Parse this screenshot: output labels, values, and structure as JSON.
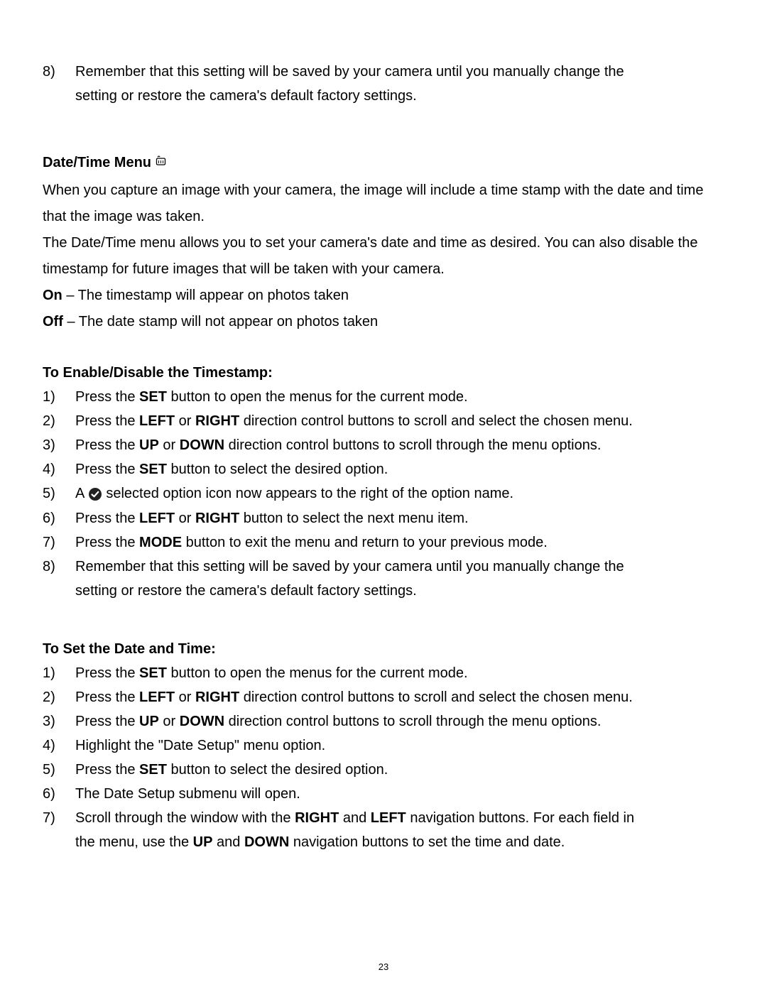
{
  "item8": {
    "num": "8)",
    "text1": "Remember that this setting will be saved by your camera until you manually change the ",
    "text2": "setting or restore the camera's default factory settings."
  },
  "dtmenu": {
    "heading": "Date/Time Menu",
    "para1": "When you capture an image with your camera, the image will include a time stamp with the date and time that the image was taken.",
    "para2": "The Date/Time menu allows you to set your camera's date and time as desired. You can also disable the timestamp for future images that will be taken with your camera.",
    "on_label": "On",
    "on_text": " – The timestamp will appear on photos taken",
    "off_label": "Off",
    "off_text": " – The date stamp will not appear on photos taken"
  },
  "ts": {
    "heading": "To Enable/Disable the Timestamp:",
    "n1": "1)",
    "t1a": "Press the ",
    "t1b": "SET",
    "t1c": " button to open the menus for the current mode.",
    "n2": "2)",
    "t2a": "Press the ",
    "t2b": "LEFT",
    "t2c": " or ",
    "t2d": "RIGHT",
    "t2e": " direction control buttons to scroll and select the chosen menu.",
    "n3": "3)",
    "t3a": "Press the ",
    "t3b": "UP",
    "t3c": " or ",
    "t3d": "DOWN",
    "t3e": " direction control buttons to scroll through the menu options.",
    "n4": "4)",
    "t4a": "Press the ",
    "t4b": "SET",
    "t4c": " button to select the desired option.",
    "n5": "5)",
    "t5a": "A  ",
    "t5b": "  selected option icon now appears to the right of the option name.",
    "n6": "6)",
    "t6a": "Press the ",
    "t6b": "LEFT",
    "t6c": " or ",
    "t6d": "RIGHT",
    "t6e": " button to select the next menu item.",
    "n7": "7)",
    "t7a": "Press the ",
    "t7b": "MODE",
    "t7c": " button to exit the menu and return to your previous mode.",
    "n8": "8)",
    "t8a": "Remember that this setting will be saved by your camera until you manually change the ",
    "t8b": "setting or restore the camera's default factory settings."
  },
  "sd": {
    "heading": "To Set the Date and Time:",
    "n1": "1)",
    "t1a": "Press the ",
    "t1b": "SET",
    "t1c": " button to open the menus for the current mode.",
    "n2": "2)",
    "t2a": "Press the ",
    "t2b": "LEFT",
    "t2c": " or ",
    "t2d": "RIGHT",
    "t2e": " direction control buttons to scroll and select the chosen menu.",
    "n3": "3)",
    "t3a": "Press the ",
    "t3b": "UP",
    "t3c": " or ",
    "t3d": "DOWN",
    "t3e": " direction control buttons to scroll through the menu options.",
    "n4": "4)",
    "t4": "Highlight the \"Date Setup\" menu option.",
    "n5": "5)",
    "t5a": "Press the ",
    "t5b": "SET",
    "t5c": " button to select the desired option.",
    "n6": "6)",
    "t6": "The Date Setup submenu will open.",
    "n7": "7)",
    "t7a": "Scroll through the window with the ",
    "t7b": "RIGHT",
    "t7c": " and ",
    "t7d": "LEFT",
    "t7e": " navigation buttons. For each field in ",
    "t7f": "the menu, use the ",
    "t7g": "UP",
    "t7h": " and ",
    "t7i": "DOWN",
    "t7j": " navigation buttons to set the time and date."
  },
  "pagenum": "23"
}
